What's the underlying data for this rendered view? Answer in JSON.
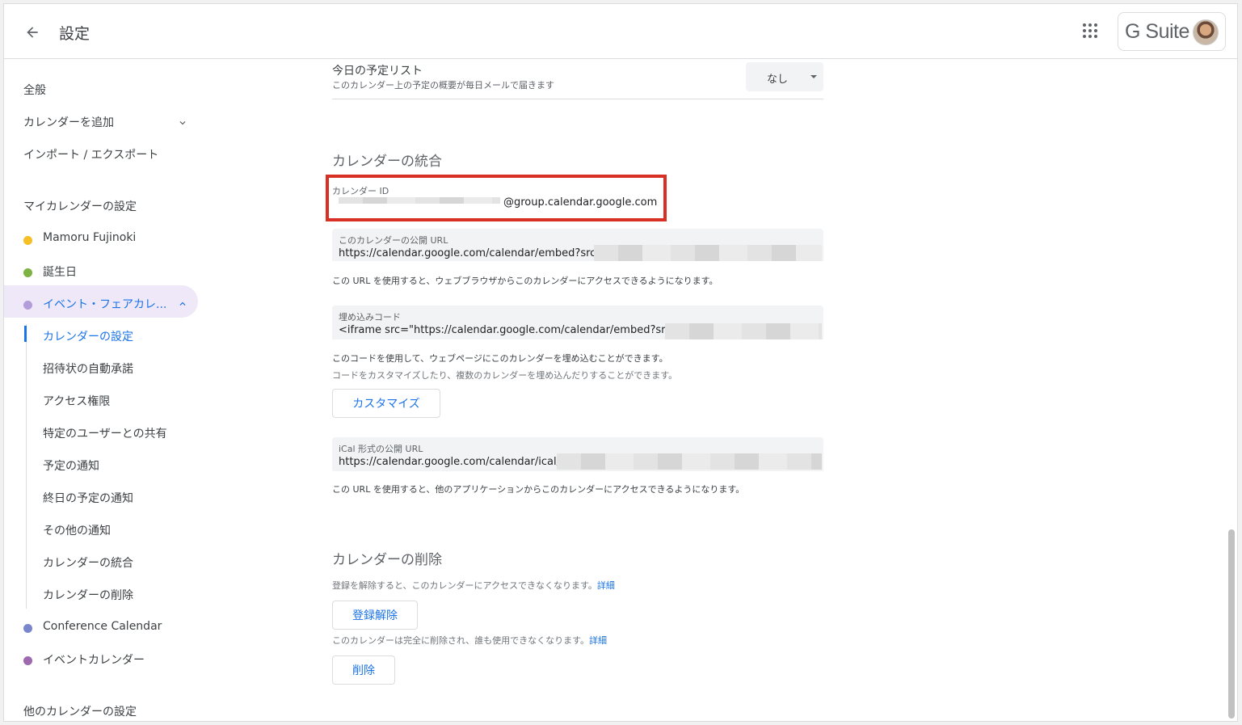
{
  "header": {
    "title": "設定",
    "brand": "G Suite"
  },
  "sidebar": {
    "general": "全般",
    "add_calendar": "カレンダーを追加",
    "import_export": "インポート / エクスポート",
    "my_calendars_heading": "マイカレンダーの設定",
    "calendars": [
      {
        "name": "Mamoru Fujinoki",
        "color": "#f6bf26"
      },
      {
        "name": "誕生日",
        "color": "#7cb342"
      },
      {
        "name": "イベント・フェアカレ...",
        "color": "#b39ddb"
      }
    ],
    "sub_items": [
      "カレンダーの設定",
      "招待状の自動承諾",
      "アクセス権限",
      "特定のユーザーとの共有",
      "予定の通知",
      "終日の予定の通知",
      "その他の通知",
      "カレンダーの統合",
      "カレンダーの削除"
    ],
    "calendars_after": [
      {
        "name": "Conference Calendar",
        "color": "#7986cb"
      },
      {
        "name": "イベントカレンダー",
        "color": "#9e69af"
      }
    ],
    "other_calendars_heading": "他のカレンダーの設定"
  },
  "daily_agenda": {
    "title": "今日の予定リスト",
    "desc": "このカレンダー上の予定の概要が毎日メールで届きます",
    "select_value": "なし"
  },
  "integration": {
    "heading": "カレンダーの統合",
    "calendar_id_label": "カレンダー ID",
    "calendar_id_value": "@group.calendar.google.com",
    "public_url_label": "このカレンダーの公開 URL",
    "public_url_value": "https://calendar.google.com/calendar/embed?src=",
    "public_url_help": "この URL を使用すると、ウェブブラウザからこのカレンダーにアクセスできるようになります。",
    "embed_label": "埋め込みコード",
    "embed_value": "<iframe src=\"https://calendar.google.com/calendar/embed?src=",
    "embed_help": "このコードを使用して、ウェブページにこのカレンダーを埋め込むことができます。",
    "embed_help2": "コードをカスタマイズしたり、複数のカレンダーを埋め込んだりすることができます。",
    "customize_button": "カスタマイズ",
    "ical_label": "iCal 形式の公開 URL",
    "ical_value": "https://calendar.google.com/calendar/ical/",
    "ical_help": "この URL を使用すると、他のアプリケーションからこのカレンダーにアクセスできるようになります。"
  },
  "deletion": {
    "heading": "カレンダーの削除",
    "unsubscribe_help": "登録を解除すると、このカレンダーにアクセスできなくなります。",
    "details_link": "詳細",
    "unsubscribe_button": "登録解除",
    "delete_help": "このカレンダーは完全に削除され、誰も使用できなくなります。",
    "details_link2": "詳細",
    "delete_button": "削除"
  }
}
